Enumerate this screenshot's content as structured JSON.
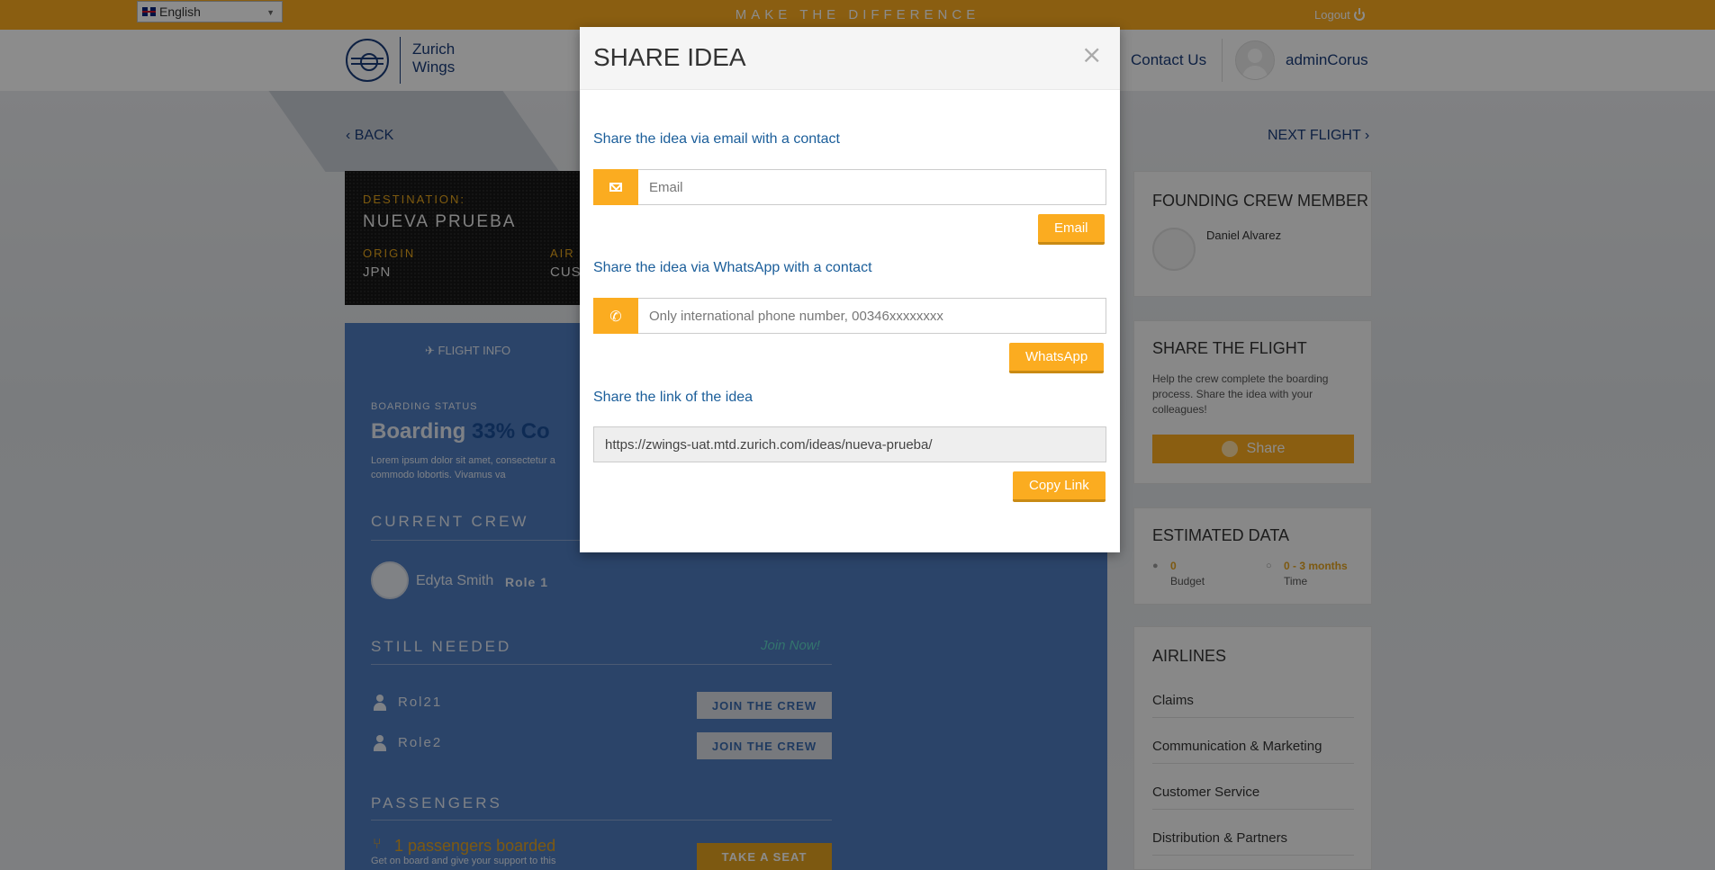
{
  "topbar": {
    "language": "English",
    "motto": "MAKE THE DIFFERENCE",
    "logout": "Logout"
  },
  "header": {
    "logo_line1": "Zurich",
    "logo_line2": "Wings",
    "contact": "Contact Us",
    "username": "adminCorus"
  },
  "page": {
    "back": "BACK",
    "next": "NEXT FLIGHT",
    "destination_label": "DESTINATION:",
    "destination": "NUEVA PRUEBA",
    "origin_label": "ORIGIN",
    "origin": "JPN",
    "airline_label": "AIR",
    "airline": "CUS",
    "tab_flight_info": "FLIGHT INFO",
    "boarding_status_label": "BOARDING STATUS",
    "boarding_word": "Boarding",
    "boarding_percent": "33% Co",
    "lorem_line1": "Lorem ipsum dolor sit amet, consectetur a",
    "lorem_line2": "commodo lobortis. Vivamus va",
    "current_crew": "CURRENT CREW",
    "crew_member": "Edyta Smith",
    "crew_role": "Role 1",
    "still_needed": "STILL NEEDED",
    "join_now": "Join Now!",
    "roles": [
      {
        "name": "Rol21",
        "button": "JOIN THE CREW"
      },
      {
        "name": "Role2",
        "button": "JOIN THE CREW"
      }
    ],
    "passengers": "PASSENGERS",
    "passengers_boarded": "1 passengers boarded",
    "passengers_sub": "Get on board and give your support to this",
    "take_seat": "TAKE A SEAT"
  },
  "sidebar": {
    "founding_title": "FOUNDING CREW MEMBER",
    "founder": "Daniel Alvarez",
    "share_title": "SHARE THE FLIGHT",
    "share_text": "Help the crew complete the boarding process. Share the idea with your colleagues!",
    "share_button": "Share",
    "estimated_title": "ESTIMATED DATA",
    "budget_value": "0",
    "budget_label": "Budget",
    "time_value": "0 - 3 months",
    "time_label": "Time",
    "airlines_title": "AIRLINES",
    "airlines": [
      "Claims",
      "Communication & Marketing",
      "Customer Service",
      "Distribution & Partners"
    ]
  },
  "modal": {
    "title": "SHARE IDEA",
    "close": "×",
    "email_label": "Share the idea via email with a contact",
    "email_placeholder": "Email",
    "email_button": "Email",
    "whatsapp_label": "Share the idea via WhatsApp with a contact",
    "whatsapp_placeholder": "Only international phone number, 00346xxxxxxxx",
    "whatsapp_button": "WhatsApp",
    "link_label": "Share the link of the idea",
    "link_value": "https://zwings-uat.mtd.zurich.com/ideas/nueva-prueba/",
    "copy_button": "Copy Link"
  },
  "colors": {
    "accent": "#fbac20",
    "brand_blue": "#1b3c7a",
    "link_blue": "#1b5e9a"
  }
}
